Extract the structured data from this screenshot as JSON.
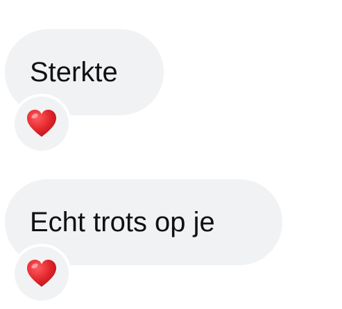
{
  "messages": [
    {
      "text": "Sterkte",
      "reaction": {
        "icon": "red-heart-icon",
        "color": "#e2262b"
      }
    },
    {
      "text": "Echt trots op je",
      "reaction": {
        "icon": "red-heart-icon",
        "color": "#e2262b"
      }
    }
  ],
  "colors": {
    "bubble": "#f1f2f4",
    "text": "#111111",
    "background": "#ffffff"
  }
}
